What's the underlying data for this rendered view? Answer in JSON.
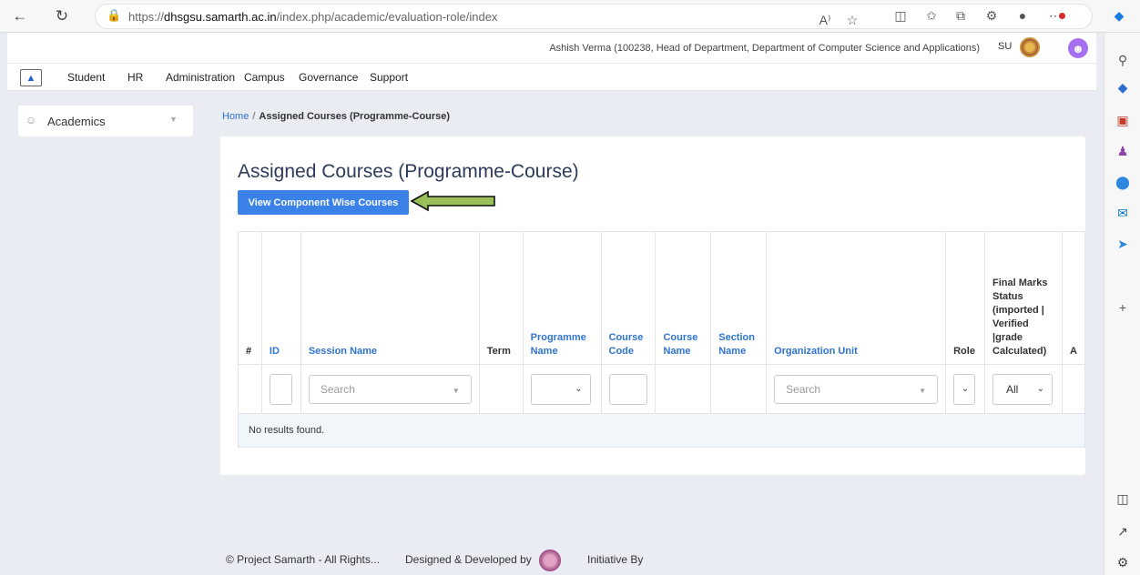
{
  "browser": {
    "url_prefix": "https://",
    "url_host": "dhsgsu.samarth.ac.in",
    "url_path": "/index.php/academic/evaluation-role/index",
    "read_aloud_label": "A⁾"
  },
  "header": {
    "user_info": "Ashish Verma (100238, Head of Department, Department of Computer Science and Applications)",
    "university_abbr": "SU"
  },
  "menu": {
    "items": [
      "Student",
      "HR",
      "Administration",
      "Campus",
      "Governance",
      "Support"
    ]
  },
  "sidebar": {
    "section_label": "Academics"
  },
  "breadcrumb": {
    "home": "Home",
    "separator": "/",
    "current": "Assigned Courses (Programme-Course)"
  },
  "main": {
    "title": "Assigned Courses (Programme-Course)",
    "view_button": "View Component Wise Courses",
    "columns": {
      "num": "#",
      "id": "ID",
      "session_name": "Session Name",
      "term": "Term",
      "programme_name": "Programme Name",
      "course_code": "Course Code",
      "course_name": "Course Name",
      "section_name": "Section Name",
      "organization_unit": "Organization Unit",
      "role": "Role",
      "final_marks_status": "Final Marks Status (imported | Verified |grade Calculated)",
      "actions_truncated": "A"
    },
    "filters": {
      "session_search_placeholder": "Search",
      "org_search_placeholder": "Search",
      "final_marks_value": "All"
    },
    "empty_message": "No results found."
  },
  "footer": {
    "copyright": "© Project Samarth - All Rights...",
    "designed_by": "Designed & Developed by",
    "initiative_by": "Initiative By"
  },
  "colors": {
    "primary_button": "#3b82e8",
    "link_blue": "#2f74d0",
    "page_bg": "#e9ecf3",
    "title_color": "#2e3a5c",
    "arrow_fill": "#9bbf58"
  }
}
